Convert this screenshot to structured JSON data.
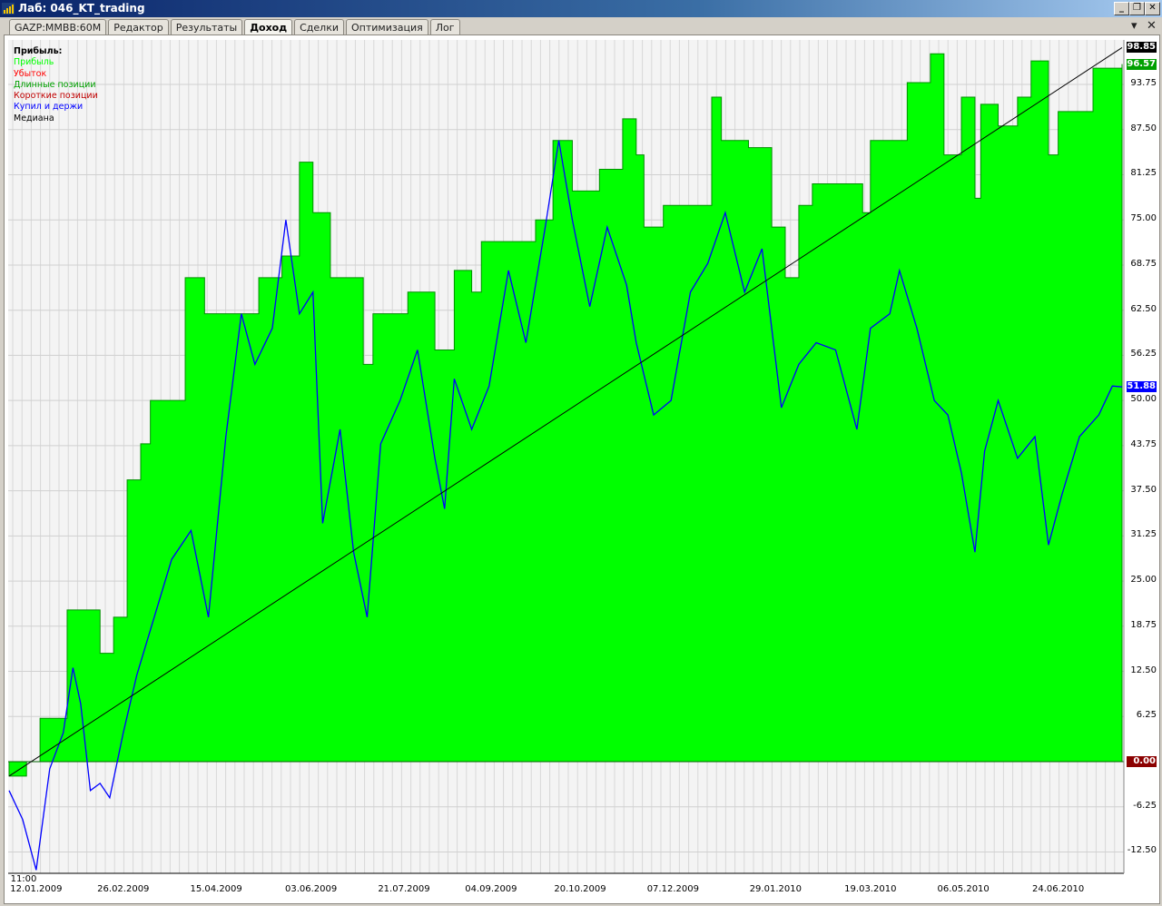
{
  "window": {
    "title": "Лаб: 046_KT_trading",
    "buttons": [
      "_",
      "❐",
      "✕"
    ]
  },
  "tabs": [
    {
      "label": "GAZP:MMBB:60M",
      "active": false
    },
    {
      "label": "Редактор",
      "active": false
    },
    {
      "label": "Результаты",
      "active": false
    },
    {
      "label": "Доход",
      "active": true
    },
    {
      "label": "Сделки",
      "active": false
    },
    {
      "label": "Оптимизация",
      "active": false
    },
    {
      "label": "Лог",
      "active": false
    }
  ],
  "tab_controls": {
    "menu": "▾",
    "close": "✕"
  },
  "legend": {
    "title": "Прибыль:",
    "items": [
      {
        "label": "Прибыль",
        "color": "#00ff00"
      },
      {
        "label": "Убыток",
        "color": "#ff0000"
      },
      {
        "label": "Длинные позиции",
        "color": "#00a000"
      },
      {
        "label": "Короткие позиции",
        "color": "#c00000"
      },
      {
        "label": "Купил и держи",
        "color": "#0000ff"
      },
      {
        "label": "Медиана",
        "color": "#000000"
      }
    ]
  },
  "chart_data": {
    "type": "area",
    "x_unit": "days since 12.01.2009",
    "time_label": "11:00",
    "xlim": [
      -14,
      561
    ],
    "ylim": [
      -15.5,
      100
    ],
    "grid": true,
    "y_ticks": [
      "93.75",
      "87.50",
      "81.25",
      "75.00",
      "68.75",
      "62.50",
      "56.25",
      "50.00",
      "43.75",
      "37.50",
      "31.25",
      "25.00",
      "18.75",
      "12.50",
      "6.25",
      "0.00",
      "-6.25",
      "-12.50"
    ],
    "x_ticks": [
      {
        "day": 0,
        "label": "12.01.2009"
      },
      {
        "day": 45,
        "label": "26.02.2009"
      },
      {
        "day": 93,
        "label": "15.04.2009"
      },
      {
        "day": 142,
        "label": "03.06.2009"
      },
      {
        "day": 190,
        "label": "21.07.2009"
      },
      {
        "day": 235,
        "label": "04.09.2009"
      },
      {
        "day": 281,
        "label": "20.10.2009"
      },
      {
        "day": 329,
        "label": "07.12.2009"
      },
      {
        "day": 382,
        "label": "29.01.2010"
      },
      {
        "day": 431,
        "label": "19.03.2010"
      },
      {
        "day": 479,
        "label": "06.05.2010"
      },
      {
        "day": 528,
        "label": "24.06.2010"
      }
    ],
    "badges": {
      "median_last": "98.85",
      "profit_last": "96.57",
      "buyhold_last": "51.88",
      "zero": "0.00"
    },
    "series": [
      {
        "name": "Прибыль",
        "color": "#00ff00",
        "points": [
          [
            -14,
            -2
          ],
          [
            -5,
            0
          ],
          [
            2,
            6
          ],
          [
            9,
            6
          ],
          [
            16,
            21
          ],
          [
            26,
            21
          ],
          [
            33,
            15
          ],
          [
            40,
            20
          ],
          [
            47,
            39
          ],
          [
            54,
            44
          ],
          [
            59,
            50
          ],
          [
            68,
            50
          ],
          [
            77,
            67
          ],
          [
            87,
            62
          ],
          [
            103,
            62
          ],
          [
            115,
            67
          ],
          [
            127,
            70
          ],
          [
            136,
            83
          ],
          [
            143,
            76
          ],
          [
            152,
            67
          ],
          [
            162,
            67
          ],
          [
            169,
            55
          ],
          [
            174,
            62
          ],
          [
            188,
            62
          ],
          [
            192,
            65
          ],
          [
            202,
            65
          ],
          [
            206,
            57
          ],
          [
            216,
            68
          ],
          [
            225,
            65
          ],
          [
            230,
            72
          ],
          [
            249,
            72
          ],
          [
            258,
            75
          ],
          [
            267,
            86
          ],
          [
            277,
            79
          ],
          [
            291,
            82
          ],
          [
            303,
            89
          ],
          [
            310,
            84
          ],
          [
            314,
            74
          ],
          [
            324,
            77
          ],
          [
            347,
            77
          ],
          [
            349,
            92
          ],
          [
            354,
            86
          ],
          [
            361,
            86
          ],
          [
            368,
            85
          ],
          [
            380,
            74
          ],
          [
            387,
            67
          ],
          [
            394,
            77
          ],
          [
            401,
            80
          ],
          [
            413,
            80
          ],
          [
            427,
            76
          ],
          [
            431,
            86
          ],
          [
            446,
            86
          ],
          [
            450,
            94
          ],
          [
            462,
            98
          ],
          [
            469,
            84
          ],
          [
            478,
            92
          ],
          [
            485,
            78
          ],
          [
            488,
            91
          ],
          [
            497,
            88
          ],
          [
            507,
            92
          ],
          [
            514,
            97
          ],
          [
            523,
            84
          ],
          [
            528,
            90
          ],
          [
            542,
            90
          ],
          [
            546,
            96
          ],
          [
            561,
            96.57
          ]
        ]
      },
      {
        "name": "Купил и держи",
        "color": "#0000ff",
        "points": [
          [
            -14,
            -4
          ],
          [
            -7,
            -8
          ],
          [
            0,
            -15
          ],
          [
            7,
            -1
          ],
          [
            14,
            4
          ],
          [
            19,
            13
          ],
          [
            23,
            8
          ],
          [
            28,
            -4
          ],
          [
            33,
            -3
          ],
          [
            38,
            -5
          ],
          [
            45,
            4
          ],
          [
            52,
            12
          ],
          [
            61,
            20
          ],
          [
            70,
            28
          ],
          [
            80,
            32
          ],
          [
            89,
            20
          ],
          [
            98,
            45
          ],
          [
            106,
            62
          ],
          [
            113,
            55
          ],
          [
            122,
            60
          ],
          [
            129,
            75
          ],
          [
            136,
            62
          ],
          [
            143,
            65
          ],
          [
            148,
            33
          ],
          [
            157,
            46
          ],
          [
            164,
            29
          ],
          [
            171,
            20
          ],
          [
            178,
            44
          ],
          [
            188,
            50
          ],
          [
            197,
            57
          ],
          [
            206,
            42
          ],
          [
            211,
            35
          ],
          [
            216,
            53
          ],
          [
            225,
            46
          ],
          [
            234,
            52
          ],
          [
            244,
            68
          ],
          [
            253,
            58
          ],
          [
            263,
            74
          ],
          [
            270,
            86
          ],
          [
            277,
            75
          ],
          [
            286,
            63
          ],
          [
            295,
            74
          ],
          [
            305,
            66
          ],
          [
            310,
            58
          ],
          [
            319,
            48
          ],
          [
            328,
            50
          ],
          [
            338,
            65
          ],
          [
            347,
            69
          ],
          [
            356,
            76
          ],
          [
            366,
            65
          ],
          [
            375,
            71
          ],
          [
            385,
            49
          ],
          [
            394,
            55
          ],
          [
            403,
            58
          ],
          [
            413,
            57
          ],
          [
            424,
            46
          ],
          [
            431,
            60
          ],
          [
            441,
            62
          ],
          [
            446,
            68
          ],
          [
            455,
            60
          ],
          [
            464,
            50
          ],
          [
            471,
            48
          ],
          [
            478,
            40
          ],
          [
            485,
            29
          ],
          [
            490,
            43
          ],
          [
            497,
            50
          ],
          [
            507,
            42
          ],
          [
            516,
            45
          ],
          [
            523,
            30
          ],
          [
            530,
            37
          ],
          [
            539,
            45
          ],
          [
            549,
            48
          ],
          [
            556,
            52
          ],
          [
            561,
            51.88
          ]
        ]
      },
      {
        "name": "Медиана",
        "color": "#000000",
        "points": [
          [
            -14,
            -2
          ],
          [
            561,
            98.85
          ]
        ]
      }
    ]
  }
}
